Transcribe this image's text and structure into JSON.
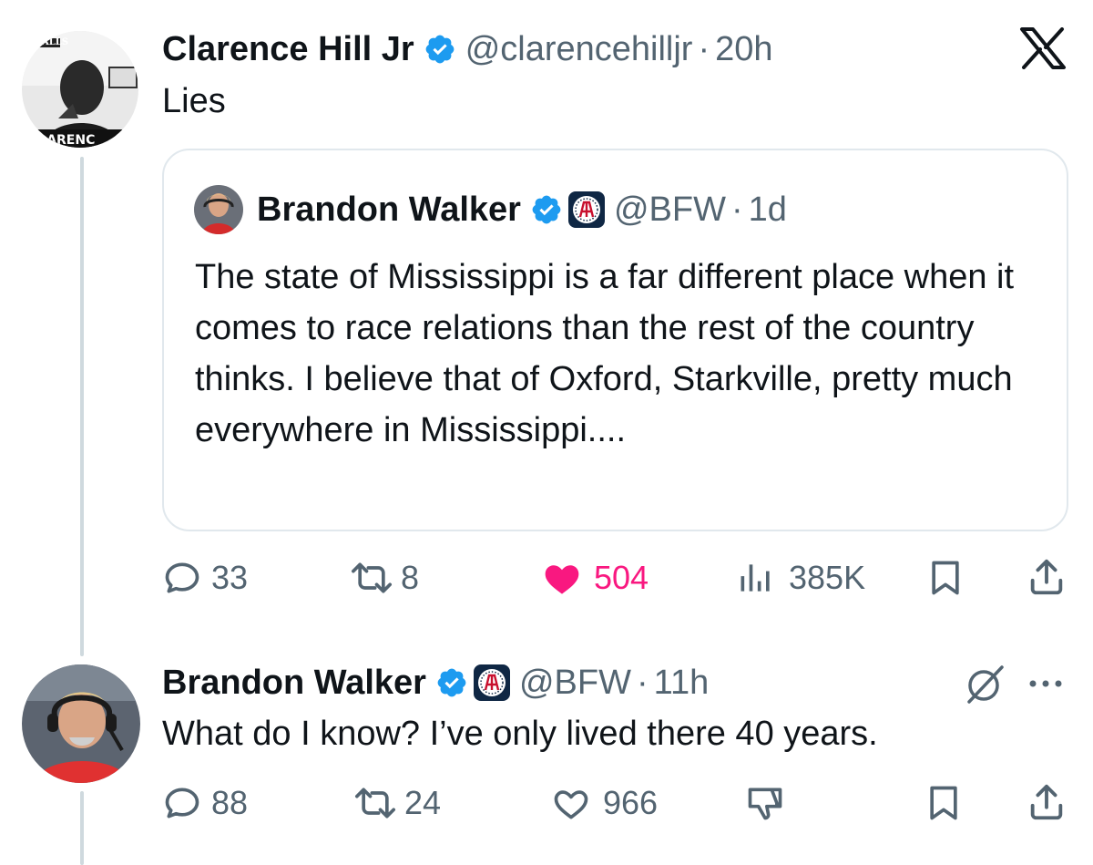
{
  "tweet1": {
    "author_name": "Clarence Hill Jr",
    "handle": "@clarencehilljr",
    "separator": "·",
    "time": "20h",
    "text": "Lies",
    "avatar_label": "CLARENC",
    "avatar_top_text": "ALLS",
    "platform_logo": "X",
    "quote": {
      "author_name": "Brandon Walker",
      "handle": "@BFW",
      "separator": "·",
      "time": "1d",
      "text": "The state of Mississippi is a far different place when it comes to race relations than the rest of the country thinks. I believe that of Oxford, Starkville, pretty much everywhere in Mississippi...."
    },
    "actions": {
      "replies": "33",
      "reposts": "8",
      "likes": "504",
      "views": "385K"
    },
    "liked": true
  },
  "tweet2": {
    "author_name": "Brandon Walker",
    "handle": "@BFW",
    "separator": "·",
    "time": "11h",
    "text": "What do I know? I’ve only lived there 40 years.",
    "actions": {
      "replies": "88",
      "reposts": "24",
      "likes": "966"
    }
  },
  "colors": {
    "text": "#0f1419",
    "secondary": "#536471",
    "verified": "#1d9bf0",
    "like_active": "#f91880",
    "border": "#e1e8ed",
    "thread_line": "#cfd9de"
  },
  "icons": [
    "verified-badge-icon",
    "barstool-badge-icon",
    "x-logo-icon",
    "reply-icon",
    "repost-icon",
    "heart-icon",
    "views-icon",
    "bookmark-icon",
    "share-icon",
    "grok-icon",
    "more-icon",
    "dislike-icon"
  ]
}
